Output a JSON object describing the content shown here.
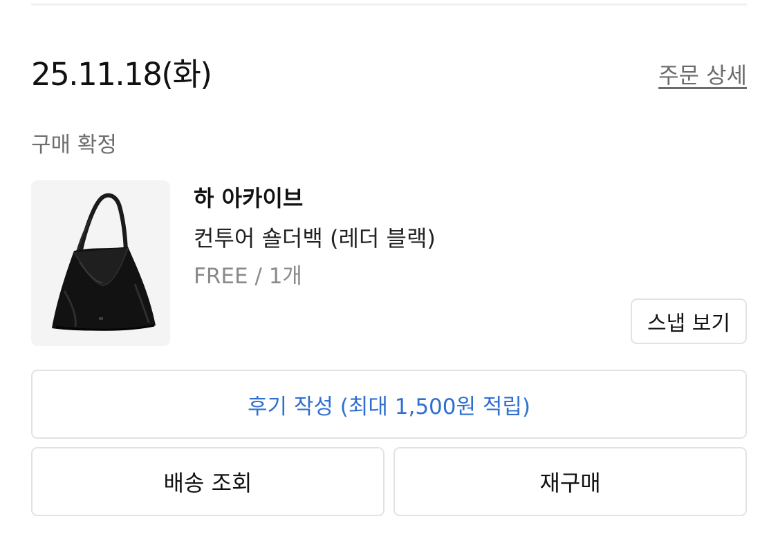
{
  "order": {
    "date": "25.11.18(화)",
    "detail_link": "주문 상세",
    "status": "구매 확정"
  },
  "product": {
    "brand": "하 아카이브",
    "name": "컨투어 숄더백 (레더 블랙)",
    "option": "FREE / 1개",
    "image_icon": "black-leather-shoulder-bag-image",
    "snap_button": "스냅 보기"
  },
  "actions": {
    "review": "후기 작성 (최대 1,500원 적립)",
    "track_shipping": "배송 조회",
    "rebuy": "재구매"
  },
  "colors": {
    "review_text": "#2f6fd1",
    "border": "#e2e2e2",
    "muted_text": "#6e6e6e",
    "thumb_bg": "#f4f4f4"
  }
}
